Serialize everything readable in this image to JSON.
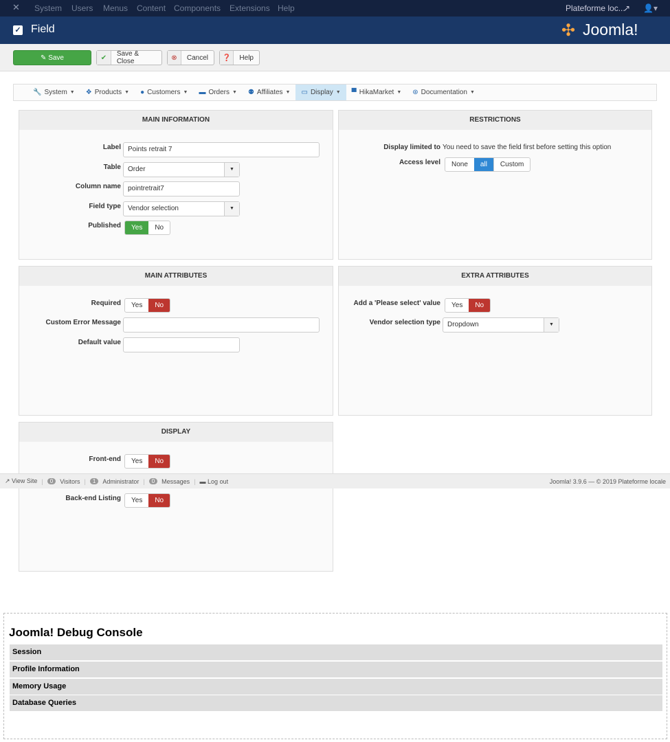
{
  "topnav": {
    "items": [
      "System",
      "Users",
      "Menus",
      "Content",
      "Components",
      "Extensions",
      "Help"
    ],
    "site": "Plateforme loc..."
  },
  "header": {
    "title": "Field",
    "logo": "Joomla!"
  },
  "toolbar": {
    "save": "Save",
    "save_close": "Save & Close",
    "cancel": "Cancel",
    "help": "Help"
  },
  "menu": [
    "System",
    "Products",
    "Customers",
    "Orders",
    "Affiliates",
    "Display",
    "HikaMarket",
    "Documentation"
  ],
  "main_info": {
    "title": "MAIN INFORMATION",
    "label_l": "Label",
    "label_v": "Points retrait 7",
    "table_l": "Table",
    "table_v": "Order",
    "col_l": "Column name",
    "col_v": "pointretrait7",
    "type_l": "Field type",
    "type_v": "Vendor selection",
    "pub_l": "Published",
    "yes": "Yes",
    "no": "No"
  },
  "restrictions": {
    "title": "RESTRICTIONS",
    "disp_l": "Display limited to",
    "disp_v": "You need to save the field first before setting this option",
    "access_l": "Access level",
    "opts": [
      "None",
      "all",
      "Custom"
    ]
  },
  "main_attr": {
    "title": "MAIN ATTRIBUTES",
    "req_l": "Required",
    "err_l": "Custom Error Message",
    "err_v": "",
    "def_l": "Default value",
    "def_v": "",
    "yes": "Yes",
    "no": "No"
  },
  "extra_attr": {
    "title": "EXTRA ATTRIBUTES",
    "please_l": "Add a 'Please select' value",
    "vtype_l": "Vendor selection type",
    "vtype_v": "Dropdown",
    "yes": "Yes",
    "no": "No"
  },
  "display": {
    "title": "DISPLAY",
    "front_l": "Front-end",
    "backlist_l": "Back-end Listing",
    "yes": "Yes",
    "no": "No"
  },
  "status": {
    "view_site": "View Site",
    "visitors_n": "0",
    "visitors": "Visitors",
    "admin_n": "1",
    "admin": "Administrator",
    "msg_n": "0",
    "messages": "Messages",
    "logout": "Log out",
    "version": "Joomla! 3.9.6 — © 2019 Plateforme locale"
  },
  "debug": {
    "title": "Joomla! Debug Console",
    "rows": [
      "Session",
      "Profile Information",
      "Memory Usage",
      "Database Queries"
    ]
  }
}
